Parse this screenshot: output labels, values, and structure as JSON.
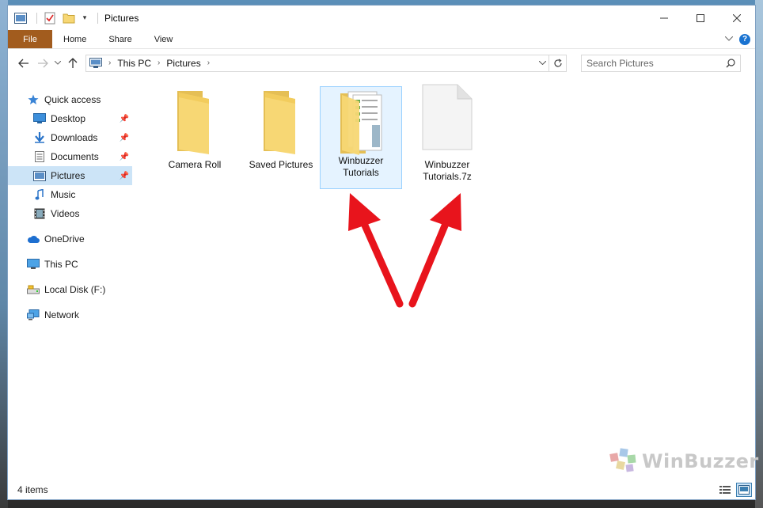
{
  "window": {
    "title": "Pictures"
  },
  "ribbon": {
    "tabs": [
      "File",
      "Home",
      "Share",
      "View"
    ],
    "help": "?"
  },
  "address": {
    "crumbs": [
      "This PC",
      "Pictures"
    ]
  },
  "search": {
    "placeholder": "Search Pictures"
  },
  "nav": {
    "items": [
      {
        "label": "Quick access",
        "icon": "star-icon"
      },
      {
        "label": "Desktop",
        "icon": "desktop-icon",
        "pinned": true
      },
      {
        "label": "Downloads",
        "icon": "download-icon",
        "pinned": true
      },
      {
        "label": "Documents",
        "icon": "documents-icon",
        "pinned": true
      },
      {
        "label": "Pictures",
        "icon": "pictures-icon",
        "pinned": true,
        "selected": true
      },
      {
        "label": "Music",
        "icon": "music-icon"
      },
      {
        "label": "Videos",
        "icon": "videos-icon"
      },
      {
        "label": "OneDrive",
        "icon": "cloud-icon"
      },
      {
        "label": "This PC",
        "icon": "computer-icon"
      },
      {
        "label": "Local Disk (F:)",
        "icon": "drive-icon"
      },
      {
        "label": "Network",
        "icon": "network-icon"
      }
    ]
  },
  "files": [
    {
      "name": "Camera Roll",
      "type": "folder"
    },
    {
      "name": "Saved Pictures",
      "type": "folder"
    },
    {
      "name": "Winbuzzer Tutorials",
      "type": "folder-with-content",
      "selected": true
    },
    {
      "name": "Winbuzzer Tutorials.7z",
      "type": "archive"
    }
  ],
  "status": {
    "count": "4 items"
  },
  "watermark": {
    "text": "WinBuzzer"
  },
  "colors": {
    "accent": "#a25c1e",
    "selection": "#cce4f7",
    "arrow": "#e8141c",
    "folder": "#f7d774"
  }
}
